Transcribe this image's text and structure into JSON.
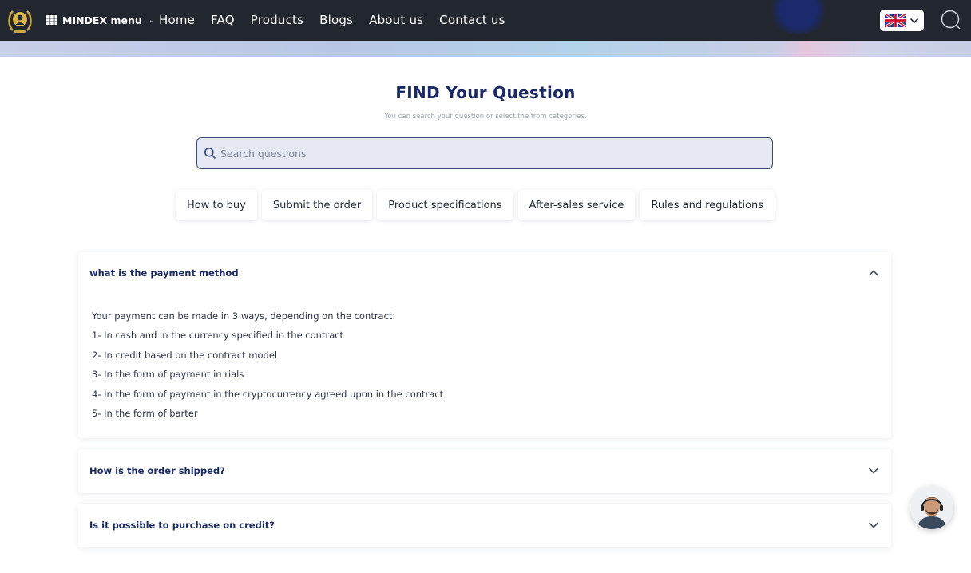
{
  "nav": {
    "menu_label": "MINDEX menu",
    "links": [
      "Home",
      "FAQ",
      "Products",
      "Blogs",
      "About us",
      "Contact us"
    ],
    "language": "English (UK flag)"
  },
  "hero": {
    "title": "FIND Your Question",
    "subtitle": "You can search your question or select the from categories."
  },
  "search": {
    "placeholder": "Search questions",
    "value": ""
  },
  "categories": [
    "How to buy",
    "Submit the order",
    "Product specifications",
    "After-sales service",
    "Rules and regulations"
  ],
  "faq": [
    {
      "question": "what is the payment method",
      "expanded": true,
      "answer": [
        "Your payment can be made in 3 ways, depending on the contract:",
        "1- In cash and in the currency specified in the contract",
        "2- In credit based on the contract model",
        "3- In the form of payment in rials",
        "4- In the form of payment in the cryptocurrency agreed upon in the contract",
        "5- In the form of barter"
      ]
    },
    {
      "question": "How is the order shipped?",
      "expanded": false
    },
    {
      "question": "Is it possible to purchase on credit?",
      "expanded": false
    }
  ],
  "colors": {
    "navbar": "#22262e",
    "title_navy": "#1b2a63",
    "search_bg": "#e6e9f4"
  }
}
